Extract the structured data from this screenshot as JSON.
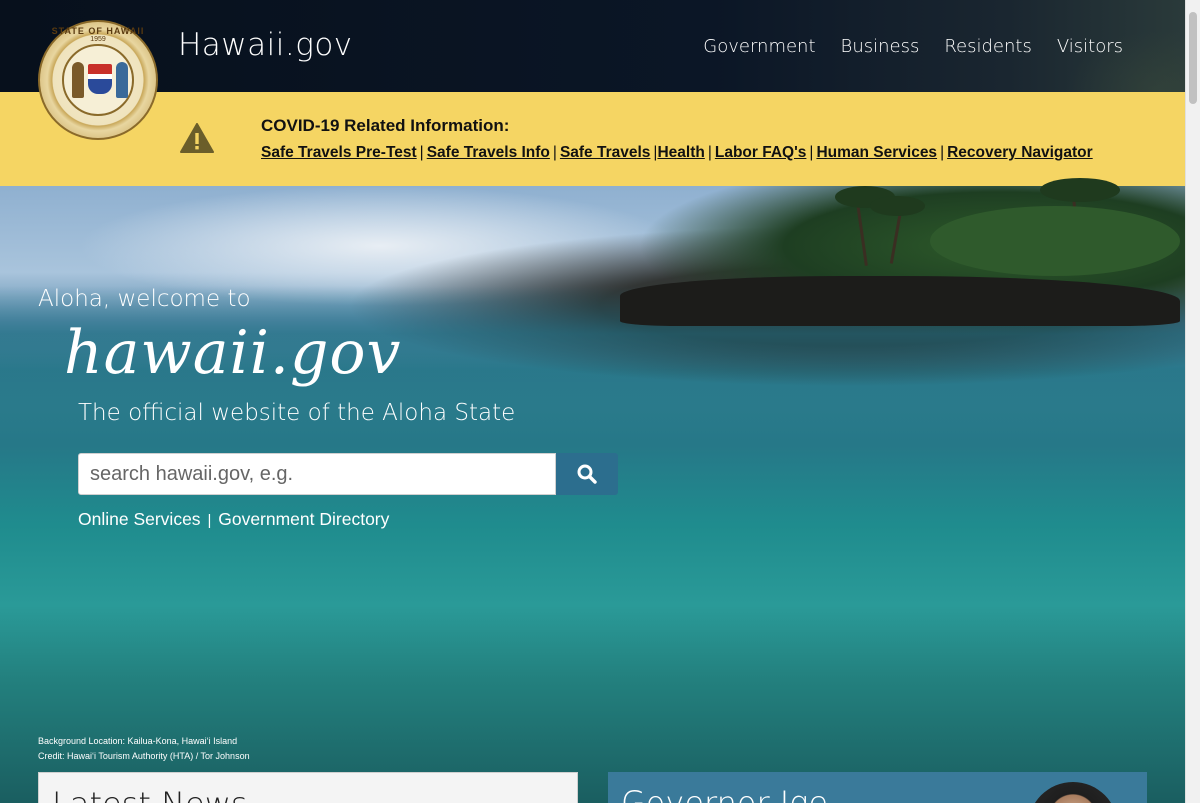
{
  "header": {
    "site_title": "Hawaii.gov",
    "nav": [
      "Government",
      "Business",
      "Residents",
      "Visitors"
    ]
  },
  "seal": {
    "text": "STATE OF HAWAII",
    "year": "1959"
  },
  "alert": {
    "icon": "warning-icon",
    "title": "COVID-19 Related Information:",
    "links": [
      "Safe Travels Pre-Test",
      "Safe Travels Info",
      "Safe Travels",
      "Health",
      "Labor FAQ's",
      "Human Services",
      "Recovery Navigator"
    ],
    "separator": "|",
    "colors": {
      "background": "#f5d563"
    }
  },
  "hero": {
    "greeting": "Aloha, welcome to",
    "script_title": "hawaii.gov",
    "tagline": "The official website of the Aloha State",
    "search": {
      "placeholder": "search hawaii.gov, e.g.",
      "button_icon": "search-icon"
    },
    "quick_links": [
      "Online Services",
      "Government Directory"
    ],
    "credit": {
      "location": "Background Location: Kailua-Kona, Hawaiʻi Island",
      "credit": "Credit: Hawaiʻi Tourism Authority (HTA) / Tor Johnson"
    }
  },
  "cards": {
    "news_title": "Latest News",
    "governor_title": "Governor Ige"
  },
  "colors": {
    "header_bg": "#0b1626",
    "accent": "#2c6e8e"
  }
}
